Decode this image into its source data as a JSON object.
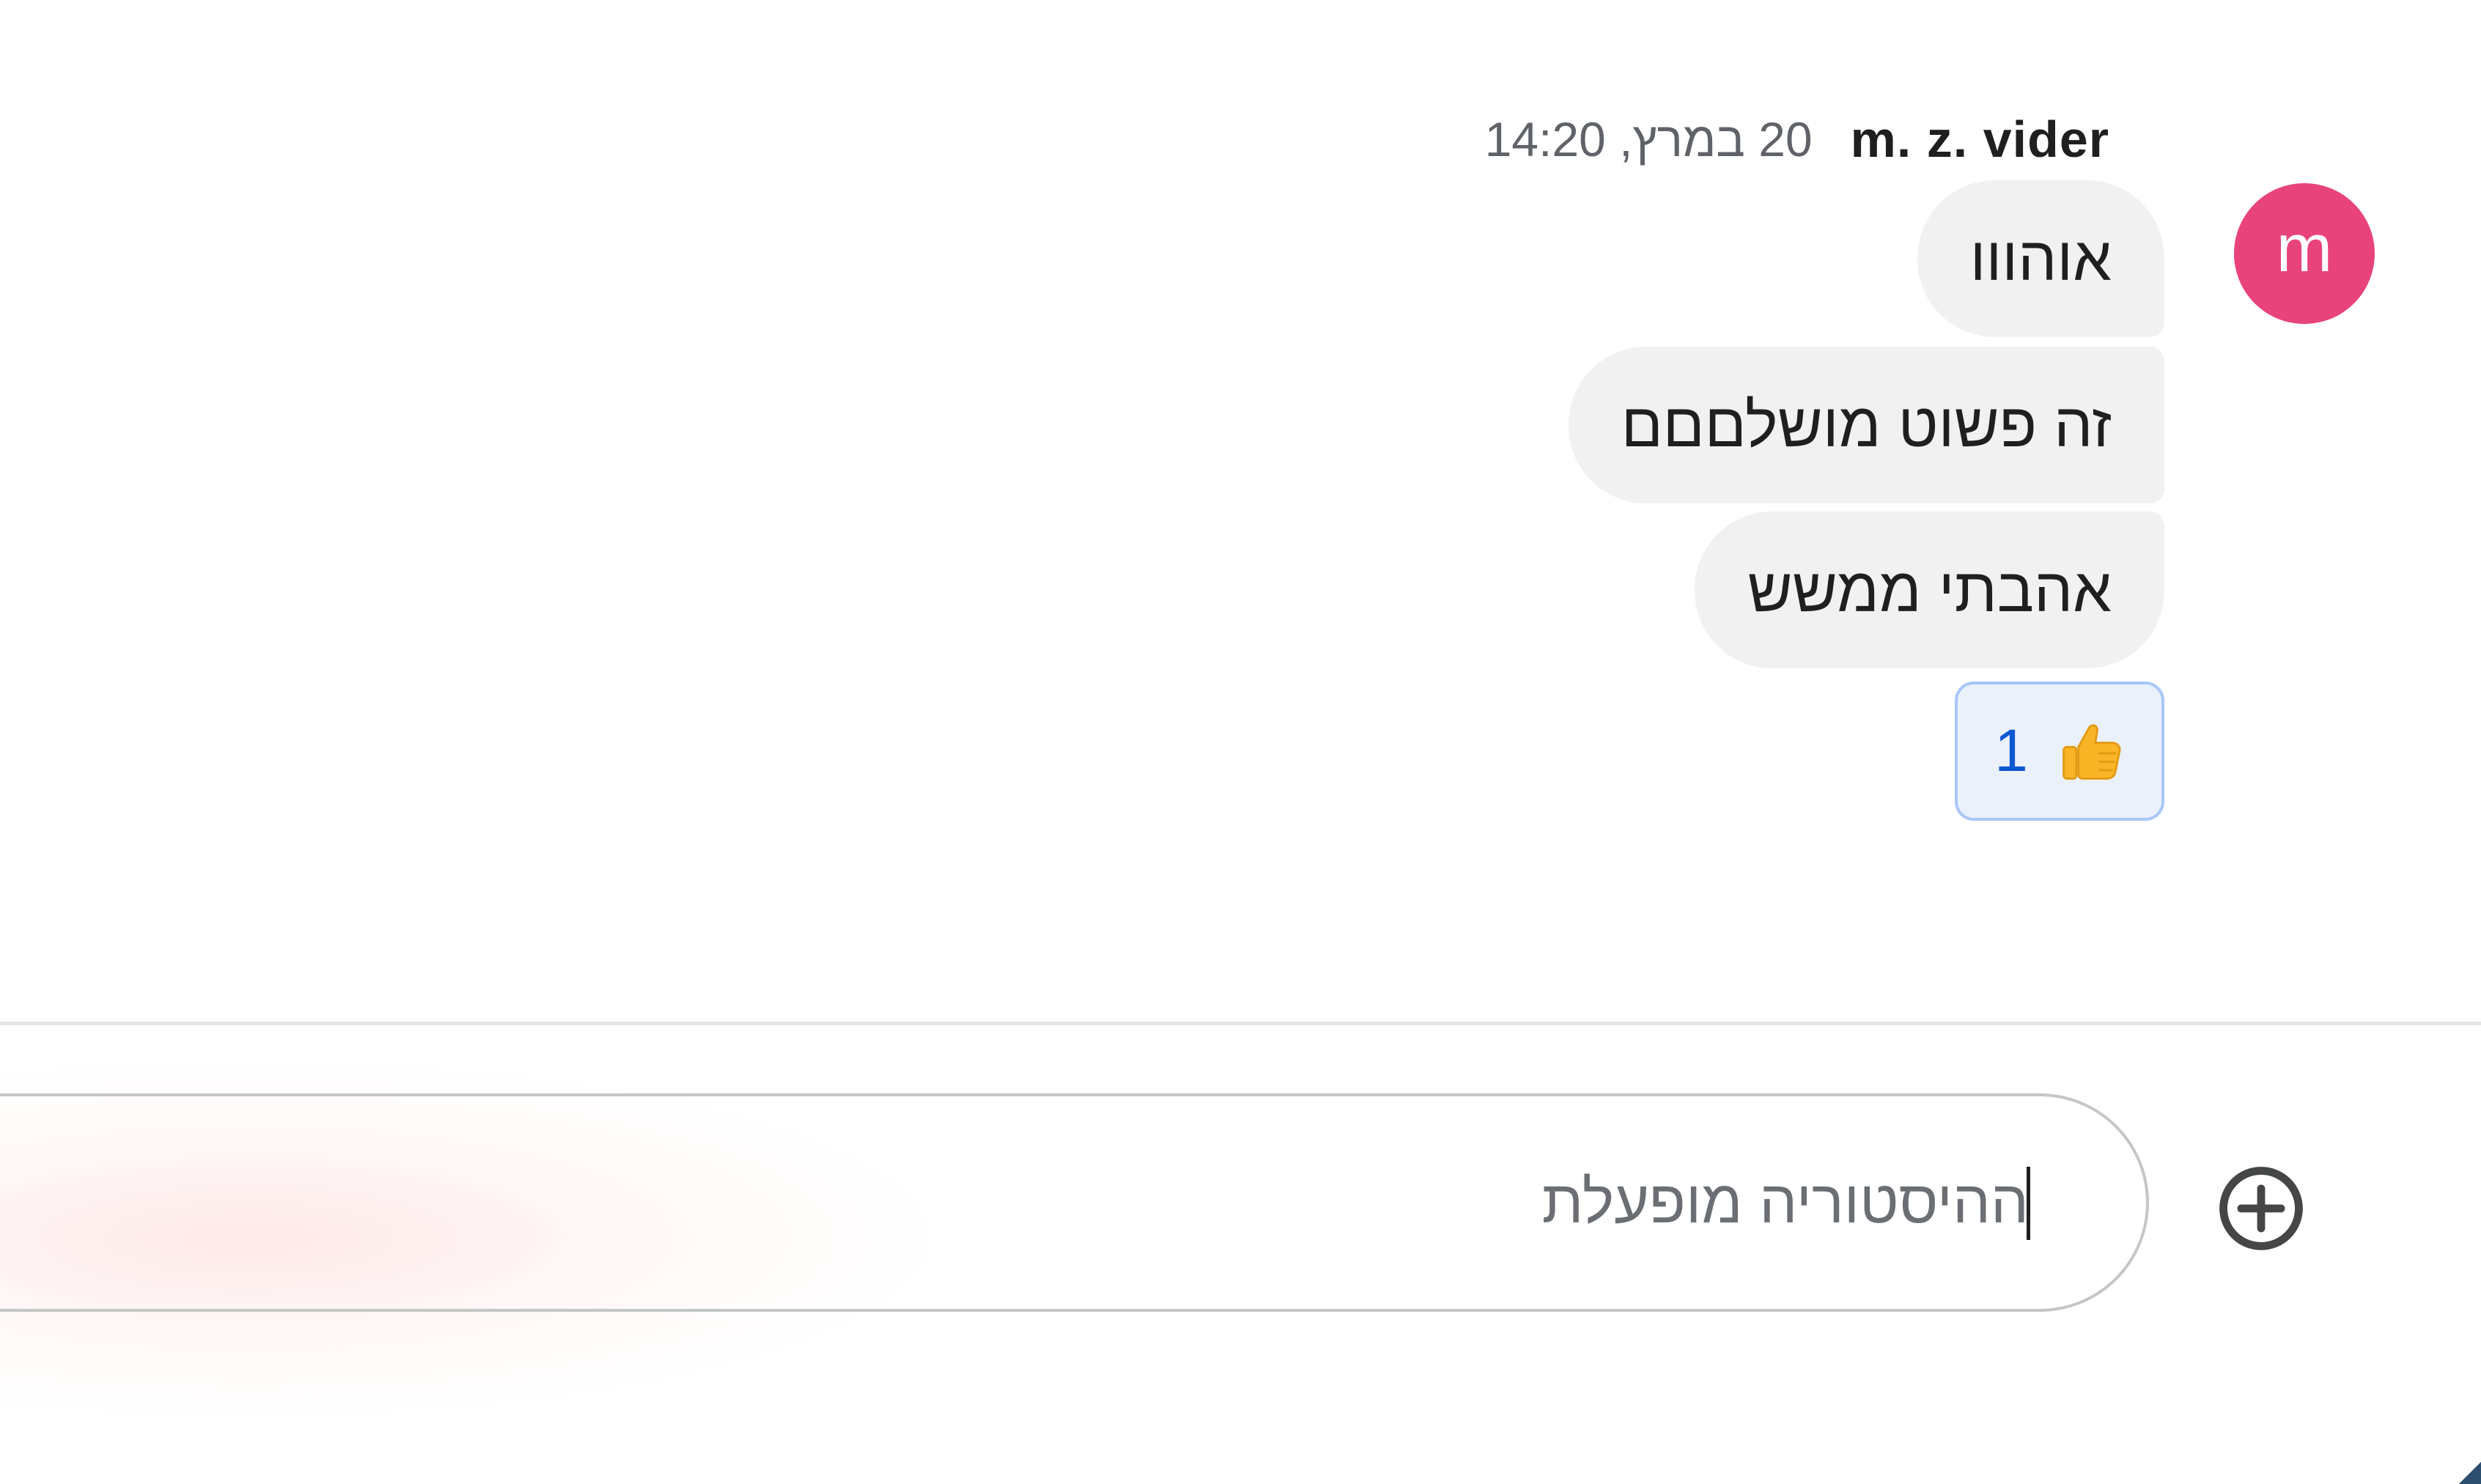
{
  "message_group": {
    "sender": {
      "initial": "m",
      "name": "m. z. vider",
      "avatar_color": "#e8437a"
    },
    "timestamp": "20 במרץ, 14:20",
    "messages": [
      {
        "text": "אוהווו"
      },
      {
        "text": "זה פשוט מושלםםם"
      },
      {
        "text": "אהבתי ממשש"
      }
    ],
    "reaction": {
      "emoji": "thumbs-up",
      "count": "1"
    }
  },
  "composer": {
    "placeholder": "ההיסטוריה מופעלת",
    "value": "",
    "add_button_icon": "plus-circle-icon"
  },
  "colors": {
    "bubble_background": "#f1f1f1",
    "reaction_background": "#eaf1fb",
    "reaction_border": "#a8c7fa",
    "reaction_count": "#0b57d0",
    "composer_border": "#c4c7c5",
    "icon": "#444746"
  }
}
